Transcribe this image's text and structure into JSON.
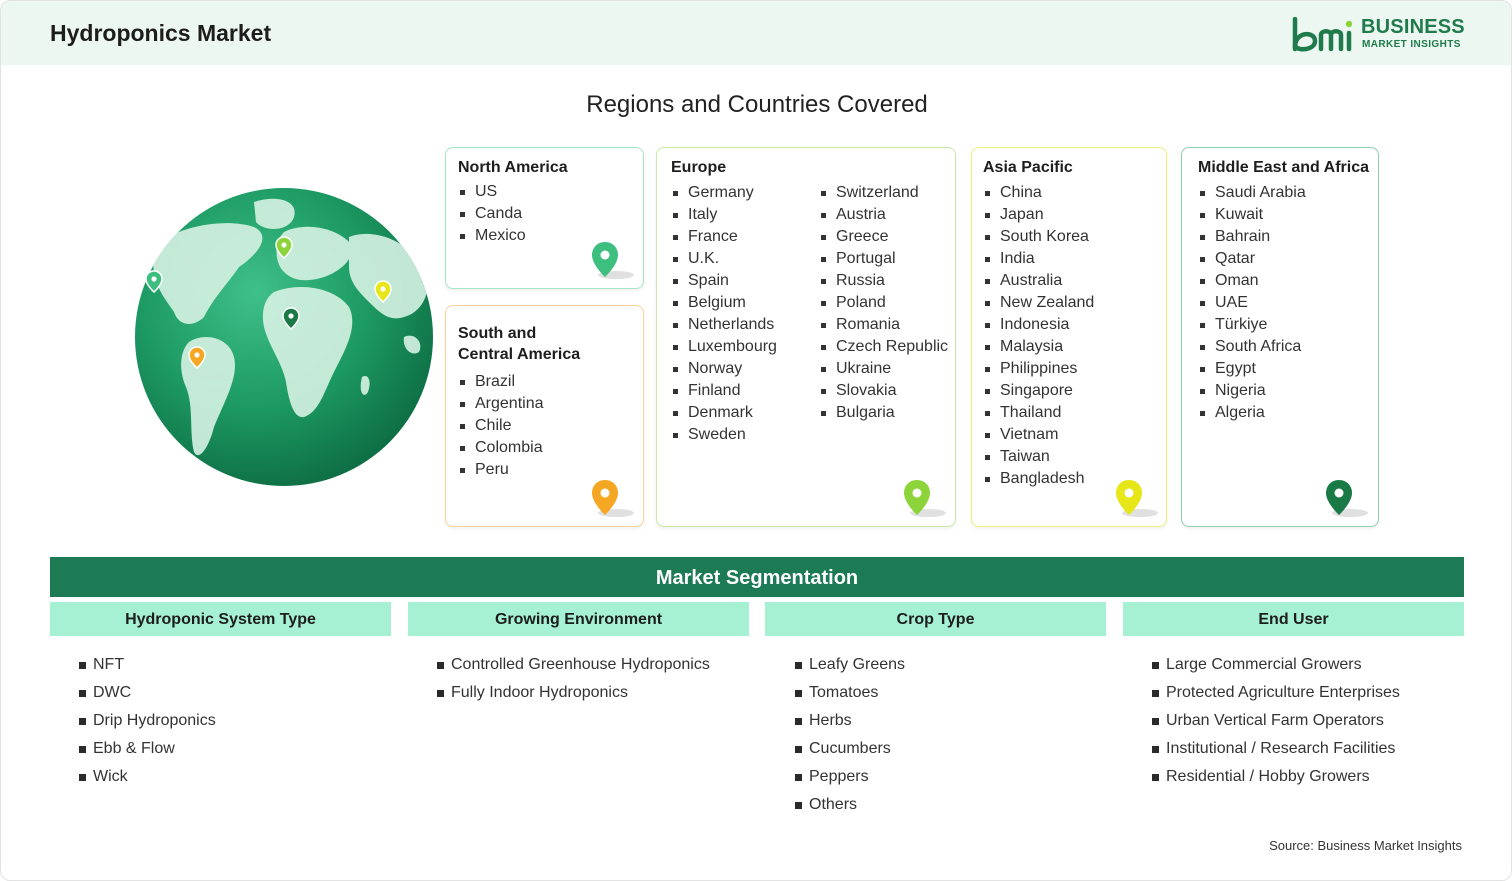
{
  "header": {
    "title": "Hydroponics Market",
    "brand_line1": "BUSINESS",
    "brand_line2": "MARKET INSIGHTS",
    "brand_color": "#1f7a4c"
  },
  "regions_title": "Regions and Countries Covered",
  "regions": {
    "north_america": {
      "name": "North America",
      "countries": [
        "US",
        "Canda",
        "Mexico"
      ],
      "color": "#3fbf7f"
    },
    "south_america": {
      "name_line1": "South and",
      "name_line2": "Central America",
      "countries": [
        "Brazil",
        "Argentina",
        "Chile",
        "Colombia",
        "Peru"
      ],
      "color": "#f5a623"
    },
    "europe": {
      "name": "Europe",
      "countries_col1": [
        "Germany",
        "Italy",
        "France",
        "U.K.",
        "Spain",
        "Belgium",
        "Netherlands",
        "Luxembourg",
        "Norway",
        "Finland",
        "Denmark",
        "Sweden"
      ],
      "countries_col2": [
        "Switzerland",
        "Austria",
        "Greece",
        "Portugal",
        "Russia",
        "Poland",
        "Romania",
        "Czech Republic",
        "Ukraine",
        "Slovakia",
        "Bulgaria"
      ],
      "color": "#8cd43a"
    },
    "asia_pacific": {
      "name": "Asia Pacific",
      "countries": [
        "China",
        "Japan",
        "South Korea",
        "India",
        "Australia",
        "New Zealand",
        "Indonesia",
        "Malaysia",
        "Philippines",
        "Singapore",
        "Thailand",
        "Vietnam",
        "Taiwan",
        "Bangladesh"
      ],
      "color": "#e6e619"
    },
    "mea": {
      "name": "Middle East and Africa",
      "countries": [
        "Saudi Arabia",
        "Kuwait",
        "Bahrain",
        "Qatar",
        "Oman",
        "UAE",
        "Türkiye",
        "South Africa",
        "Egypt",
        "Nigeria",
        "Algeria"
      ],
      "color": "#1a7a45"
    }
  },
  "segmentation": {
    "title": "Market Segmentation",
    "columns": [
      {
        "header": "Hydroponic System Type",
        "items": [
          "NFT",
          "DWC",
          "Drip Hydroponics",
          "Ebb & Flow",
          "Wick"
        ]
      },
      {
        "header": "Growing Environment",
        "items": [
          "Controlled Greenhouse Hydroponics",
          "Fully Indoor Hydroponics"
        ]
      },
      {
        "header": "Crop Type",
        "items": [
          "Leafy Greens",
          "Tomatoes",
          "Herbs",
          "Cucumbers",
          "Peppers",
          "Others"
        ]
      },
      {
        "header": "End User",
        "items": [
          "Large Commercial Growers",
          "Protected Agriculture Enterprises",
          "Urban Vertical Farm Operators",
          "Institutional / Research Facilities",
          "Residential / Hobby Growers"
        ]
      }
    ]
  },
  "source": "Source: Business Market Insights"
}
